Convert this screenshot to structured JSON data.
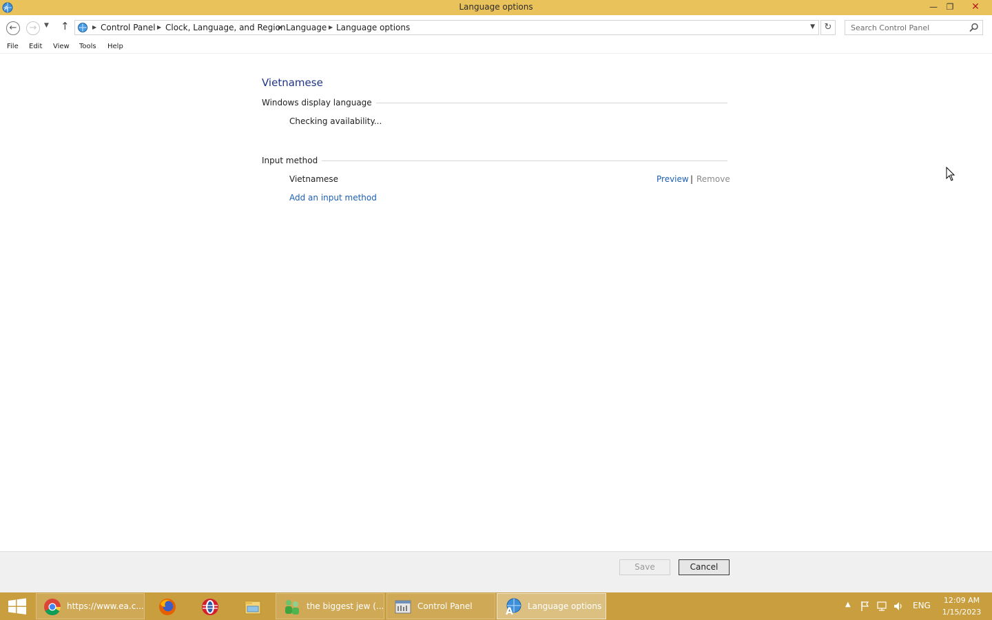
{
  "window": {
    "title": "Language options"
  },
  "navigation": {
    "breadcrumbs": [
      "Control Panel",
      "Clock, Language, and Region",
      "Language",
      "Language options"
    ],
    "search_placeholder": "Search Control Panel"
  },
  "menu": {
    "items": [
      "File",
      "Edit",
      "View",
      "Tools",
      "Help"
    ]
  },
  "content": {
    "language_name": "Vietnamese",
    "display_language": {
      "heading": "Windows display language",
      "status": "Checking availability..."
    },
    "input_method": {
      "heading": "Input method",
      "item_name": "Vietnamese",
      "preview_label": "Preview",
      "separator": "|",
      "remove_label": "Remove",
      "add_label": "Add an input method"
    }
  },
  "footer": {
    "save_label": "Save",
    "cancel_label": "Cancel"
  },
  "taskbar": {
    "items": [
      {
        "label": "https://www.ea.c...",
        "icon": "chrome-icon"
      },
      {
        "label": "",
        "icon": "firefox-icon"
      },
      {
        "label": "",
        "icon": "opera-icon"
      },
      {
        "label": "",
        "icon": "file-explorer-icon"
      },
      {
        "label": "the biggest jew (...",
        "icon": "chat-icon"
      },
      {
        "label": "Control Panel",
        "icon": "control-panel-icon"
      },
      {
        "label": "Language options",
        "icon": "language-icon"
      }
    ],
    "tray": {
      "language": "ENG",
      "time": "12:09 AM",
      "date": "1/15/2023"
    }
  },
  "colors": {
    "title_bar": "#e9c25c",
    "taskbar": "#c99e3f",
    "link": "#1a5fb4",
    "heading": "#1e3287"
  }
}
